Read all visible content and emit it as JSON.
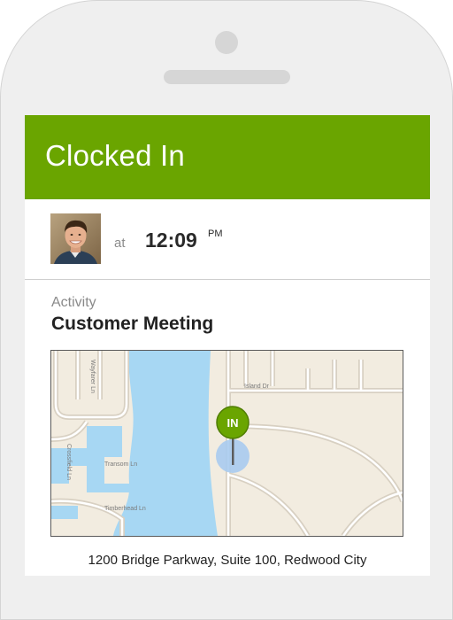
{
  "header": {
    "title": "Clocked In"
  },
  "clock": {
    "at_label": "at",
    "time": "12:09",
    "ampm": "PM"
  },
  "activity": {
    "label": "Activity",
    "value": "Customer Meeting"
  },
  "map": {
    "pin_label": "IN",
    "street_labels": [
      "Island Dr",
      "Transom Ln",
      "Timberhead Ln",
      "Crossfield Ln",
      "Wayfarer Ln"
    ],
    "colors": {
      "water": "#a7d7f3",
      "land": "#f2ece0",
      "pin": "#6aa500",
      "accuracy": "#a9cbef"
    }
  },
  "address": "1200 Bridge Parkway, Suite 100, Redwood City",
  "colors": {
    "accent": "#6aa500"
  }
}
